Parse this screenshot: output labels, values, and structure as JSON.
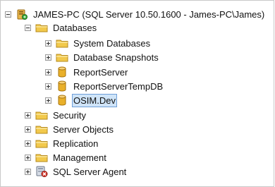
{
  "tree": {
    "server": {
      "label": "JAMES-PC (SQL Server 10.50.1600 - James-PC\\James)",
      "icon": "server-icon",
      "state": "expanded"
    },
    "databases": {
      "label": "Databases",
      "icon": "folder-icon",
      "state": "expanded",
      "children": [
        {
          "label": "System Databases",
          "icon": "folder-icon",
          "state": "collapsed"
        },
        {
          "label": "Database Snapshots",
          "icon": "folder-icon",
          "state": "collapsed"
        },
        {
          "label": "ReportServer",
          "icon": "database-icon",
          "state": "collapsed"
        },
        {
          "label": "ReportServerTempDB",
          "icon": "database-icon",
          "state": "collapsed"
        },
        {
          "label": "OSIM.Dev",
          "icon": "database-icon",
          "state": "collapsed",
          "selected": true
        }
      ]
    },
    "others": [
      {
        "label": "Security",
        "icon": "folder-icon",
        "state": "collapsed"
      },
      {
        "label": "Server Objects",
        "icon": "folder-icon",
        "state": "collapsed"
      },
      {
        "label": "Replication",
        "icon": "folder-icon",
        "state": "collapsed"
      },
      {
        "label": "Management",
        "icon": "folder-icon",
        "state": "collapsed"
      },
      {
        "label": "SQL Server Agent",
        "icon": "sql-agent-icon",
        "state": "collapsed"
      }
    ]
  },
  "colors": {
    "selection_fill": "#cfe4f8",
    "selection_border": "#6f9fd8",
    "folder": "#f2c94c",
    "database": "#e9b02a"
  }
}
